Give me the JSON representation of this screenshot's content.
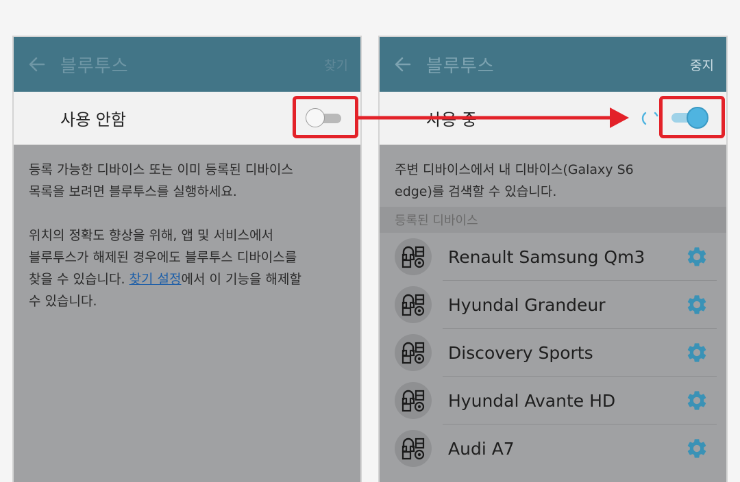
{
  "left": {
    "title": "블루투스",
    "action": "찾기",
    "toggle_label": "사용 안함",
    "toggle_state": "off",
    "para1_line1": "등록 가능한 디바이스 또는 이미 등록된 디바이스",
    "para1_line2": "목록을 보려면 블루투스를 실행하세요.",
    "para2_line1": "위치의 정확도 향상을 위해, 앱 및 서비스에서",
    "para2_line2": "블루투스가 해제된 경우에도 블루투스 디바이스를",
    "para2_line3a": "찾을 수 있습니다. ",
    "para2_link": "찾기 설정",
    "para2_line3b": "에서 이 기능을 해제할",
    "para2_line4": "수 있습니다."
  },
  "right": {
    "title": "블루투스",
    "action": "중지",
    "toggle_label": "사용 중",
    "toggle_state": "on",
    "desc_line1": "주변 디바이스에서 내 디바이스(Galaxy S6",
    "desc_line2": "edge)를 검색할 수 있습니다.",
    "section_header": "등록된 디바이스",
    "devices": [
      {
        "name": "Renault Samsung Qm3",
        "icon": "headset-device-icon"
      },
      {
        "name": "Hyundal Grandeur",
        "icon": "headset-device-icon"
      },
      {
        "name": "Discovery Sports",
        "icon": "headset-device-icon"
      },
      {
        "name": "Hyundal Avante HD",
        "icon": "headset-device-icon"
      },
      {
        "name": "Audi A7",
        "icon": "headset-device-icon"
      }
    ]
  },
  "colors": {
    "appbar": "#427587",
    "highlight": "#e32229",
    "switch_on": "#4fb4e0",
    "link": "#1c5ea8"
  }
}
